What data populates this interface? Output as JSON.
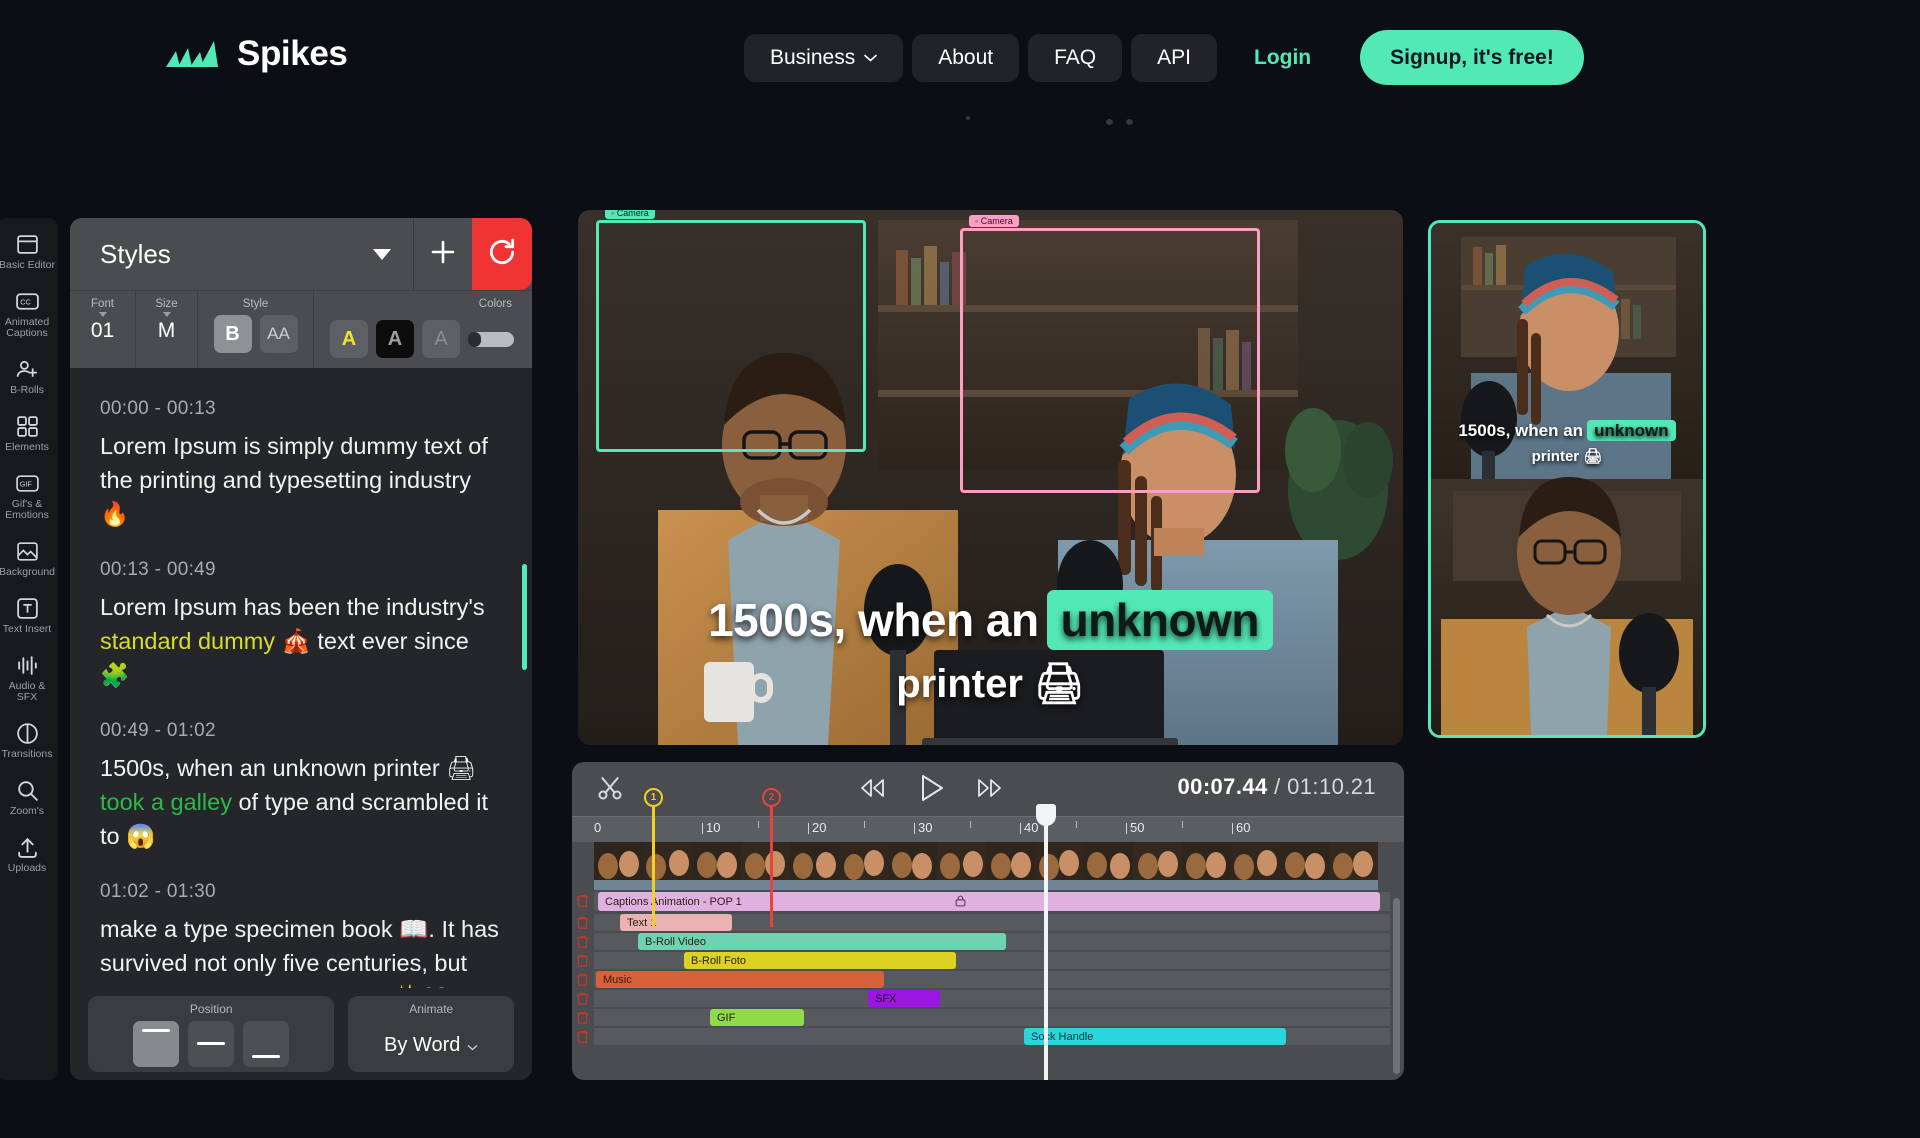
{
  "brand": {
    "name": "Spikes",
    "logo_icon": "spikes-logo-icon",
    "accent": "#53e9b6"
  },
  "nav": {
    "items": [
      {
        "label": "Business",
        "has_dropdown": true,
        "icon": "chevron-down-icon"
      },
      {
        "label": "About",
        "has_dropdown": false
      },
      {
        "label": "FAQ",
        "has_dropdown": false
      },
      {
        "label": "API",
        "has_dropdown": false
      }
    ],
    "login_label": "Login",
    "signup_label": "Signup, it's free!"
  },
  "rail": {
    "items": [
      {
        "icon": "basic-editor-icon",
        "label": "Basic Editor"
      },
      {
        "icon": "cc-icon",
        "label": "Animated Captions"
      },
      {
        "icon": "b-rolls-icon",
        "label": "B-Rolls"
      },
      {
        "icon": "elements-icon",
        "label": "Elements"
      },
      {
        "icon": "gif-icon",
        "label": "Gif's & Emotions"
      },
      {
        "icon": "background-icon",
        "label": "Background"
      },
      {
        "icon": "text-insert-icon",
        "label": "Text Insert"
      },
      {
        "icon": "audio-sfx-icon",
        "label": "Audio & SFX"
      },
      {
        "icon": "transitions-icon",
        "label": "Transitions"
      },
      {
        "icon": "zooms-icon",
        "label": "Zoom's"
      },
      {
        "icon": "uploads-icon",
        "label": "Uploads"
      }
    ]
  },
  "panel": {
    "title": "Styles",
    "dropdown_icon": "chevron-down-icon",
    "add_icon": "plus-icon",
    "reset_icon": "reset-circle-icon",
    "toolbar": {
      "font": {
        "caption": "Font",
        "value": "01"
      },
      "size": {
        "caption": "Size",
        "value": "M"
      },
      "style": {
        "caption": "Style",
        "bold_label": "B",
        "bold_active": true,
        "case_label": "AA",
        "case_active": false
      },
      "colors": {
        "caption": "Colors",
        "text_color_label": "A",
        "text_color": "#f5e131",
        "bg_color_label": "A",
        "bg_color": "#0c0c0c",
        "outline_label": "A",
        "opacity_slider": "opacity-slider"
      }
    },
    "captions": [
      {
        "time": "00:00 - 00:13",
        "segments": [
          {
            "text": "Lorem Ipsum is simply dummy text of the printing and typesetting industry ",
            "style": "plain"
          },
          {
            "text": "🔥",
            "style": "emoji"
          }
        ]
      },
      {
        "time": "00:13 - 00:49",
        "segments": [
          {
            "text": "Lorem Ipsum has been the industry's ",
            "style": "plain"
          },
          {
            "text": "standard dummy",
            "style": "yellow"
          },
          {
            "text": " 🎪 text ever since 🧩",
            "style": "plain"
          }
        ]
      },
      {
        "time": "00:49 - 01:02",
        "segments": [
          {
            "text": "1500s, when an unknown printer 🖨 ",
            "style": "plain"
          },
          {
            "text": "took a galley",
            "style": "green"
          },
          {
            "text": " of type and scrambled it to 😱",
            "style": "plain"
          }
        ]
      },
      {
        "time": "01:02 - 01:30",
        "segments": [
          {
            "text": "make a type specimen book 📖. It has survived not only five centuries, but also the leap into electronic ✨👀",
            "style": "plain"
          }
        ]
      }
    ],
    "footer": {
      "position": {
        "caption": "Position",
        "options": [
          "top",
          "middle",
          "bottom"
        ],
        "selected": "top"
      },
      "animate": {
        "caption": "Animate",
        "value": "By Word",
        "icon": "chevron-down-icon"
      }
    }
  },
  "preview": {
    "caption_line1_pre": "1500s, when an",
    "caption_highlight": "unknown",
    "caption_line2": "printer 🖨",
    "face_boxes": [
      {
        "label": "◦ Camera",
        "color": "#53e9b6"
      },
      {
        "label": "◦ Camera",
        "color": "#ff9ec4"
      }
    ]
  },
  "vertical_preview": {
    "caption_line1_pre": "1500s, when an",
    "caption_highlight": "unknown",
    "caption_line2": "printer 🖨",
    "border_color": "#53e9b6"
  },
  "timeline": {
    "cut_icon": "scissors-icon",
    "transport": {
      "rewind_icon": "rewind-icon",
      "play_icon": "play-icon",
      "forward_icon": "fast-forward-icon"
    },
    "current_time": "00:07.44",
    "separator": " / ",
    "total_time": "01:10.21",
    "ruler_ticks": [
      "0",
      "10",
      "20",
      "30",
      "40",
      "50",
      "60"
    ],
    "markers": [
      {
        "number": "1",
        "color": "#f2d024",
        "position_pct": 7.5
      },
      {
        "number": "2",
        "color": "#e8443b",
        "position_pct": 25.9
      }
    ],
    "playhead_label": "playhead",
    "tracks": [
      {
        "name": "Captions Animation - POP 1",
        "color": "#e0b1e0",
        "left_pct": 0.5,
        "width_pct": 98,
        "icon": "lock-icon",
        "delete_icon": "trash-icon"
      },
      {
        "name": "Text 1",
        "color": "#e8b3b0",
        "left_pct": 3.2,
        "width_pct": 14,
        "delete_icon": "trash-icon"
      },
      {
        "name": "B-Roll Video",
        "color": "#6dd3b0",
        "left_pct": 6.0,
        "width_pct": 56.5,
        "delete_icon": "trash-icon"
      },
      {
        "name": "B-Roll Foto",
        "color": "#dbd223",
        "left_pct": 13.0,
        "width_pct": 42,
        "delete_icon": "trash-icon"
      },
      {
        "name": "Music",
        "color": "#d8603a",
        "left_pct": 0.4,
        "width_pct": 43,
        "delete_icon": "trash-icon"
      },
      {
        "name": "SFX",
        "color": "#9b16e0",
        "left_pct": 38.5,
        "width_pct": 10,
        "delete_icon": "trash-icon"
      },
      {
        "name": "GIF",
        "color": "#8fd94a",
        "left_pct": 16.0,
        "width_pct": 14,
        "delete_icon": "trash-icon"
      },
      {
        "name": "Sock Handle",
        "color": "#2ad6dc",
        "left_pct": 61.0,
        "width_pct": 38,
        "delete_icon": "trash-icon"
      }
    ]
  }
}
